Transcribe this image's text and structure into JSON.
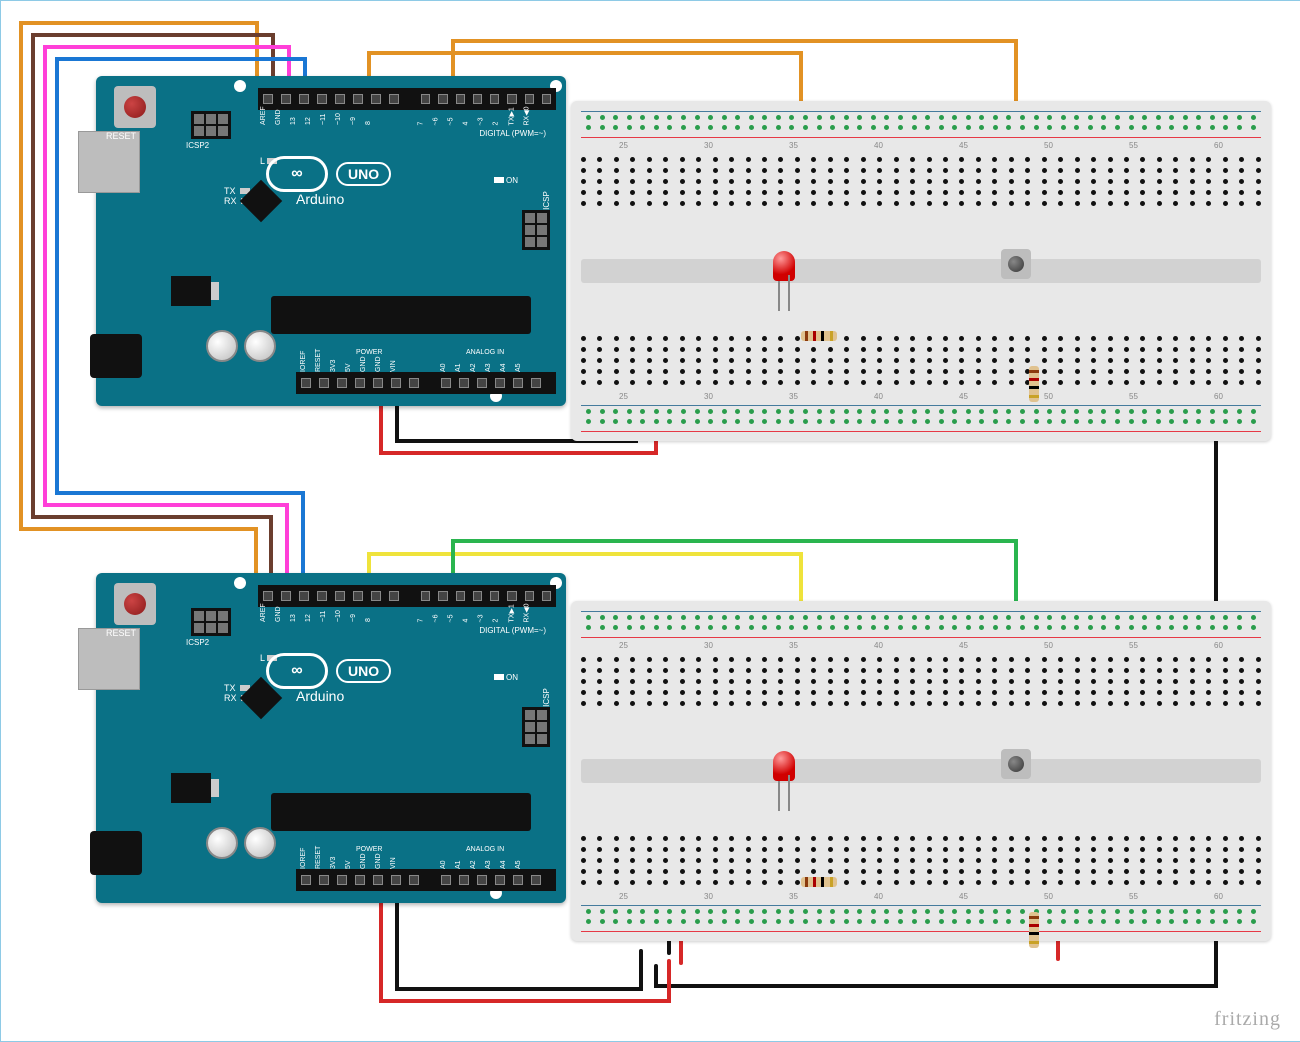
{
  "watermark": "fritzing",
  "arduino": {
    "reset": "RESET",
    "icsp2": "ICSP2",
    "icsp": "ICSP",
    "digital": "DIGITAL (PWM=~)",
    "ardtext": "Arduino",
    "uno": "UNO",
    "L": "L",
    "tx": "TX",
    "rx": "RX",
    "on": "ON",
    "power": "POWER",
    "analog": "ANALOG IN",
    "topPins": [
      "AREF",
      "GND",
      "13",
      "12",
      "~11",
      "~10",
      "~9",
      "8",
      "7",
      "~6",
      "~5",
      "4",
      "~3",
      "2",
      "TX▶1",
      "RX◀0"
    ],
    "botPinsPower": [
      "IOREF",
      "RESET",
      "3V3",
      "5V",
      "GND",
      "GND",
      "VIN"
    ],
    "botPinsAnalog": [
      "A0",
      "A1",
      "A2",
      "A3",
      "A4",
      "A5"
    ]
  },
  "breadboard": {
    "numbers": [
      25,
      30,
      35,
      40,
      45,
      50,
      55,
      60
    ]
  },
  "components": {
    "led": "LED (red)",
    "resistor": "220Ω resistor",
    "pulldown": "10kΩ resistor",
    "button": "pushbutton"
  },
  "wires": {
    "colors": {
      "orange": "#e29224",
      "brown": "#6b3e2e",
      "pink": "#ff3fd8",
      "blue": "#1a77d4",
      "yellow": "#efe33b",
      "green": "#2ab54f",
      "red": "#d62828",
      "black": "#111111"
    }
  }
}
